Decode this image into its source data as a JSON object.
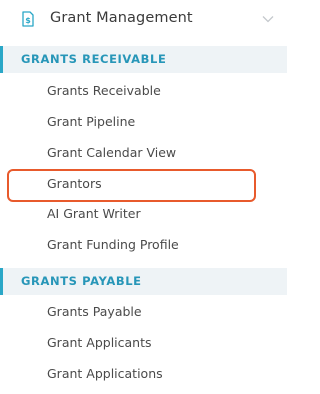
{
  "header": {
    "title": "Grant Management",
    "icon": "document-dollar-icon",
    "chevron_icon": "chevron-down-icon"
  },
  "sections": [
    {
      "label": "GRANTS RECEIVABLE",
      "items": [
        {
          "label": "Grants Receivable"
        },
        {
          "label": "Grant Pipeline"
        },
        {
          "label": "Grant Calendar View"
        },
        {
          "label": "Grantors",
          "highlighted": true
        },
        {
          "label": "AI Grant Writer"
        },
        {
          "label": "Grant Funding Profile"
        }
      ]
    },
    {
      "label": "GRANTS PAYABLE",
      "items": [
        {
          "label": "Grants Payable"
        },
        {
          "label": "Grant Applicants"
        },
        {
          "label": "Grant Applications"
        }
      ]
    }
  ],
  "colors": {
    "accent": "#2aa7c7",
    "section_bg": "#eef3f6",
    "section_text": "#2796b8",
    "highlight": "#e85a2c",
    "text": "#4a4a4a"
  }
}
